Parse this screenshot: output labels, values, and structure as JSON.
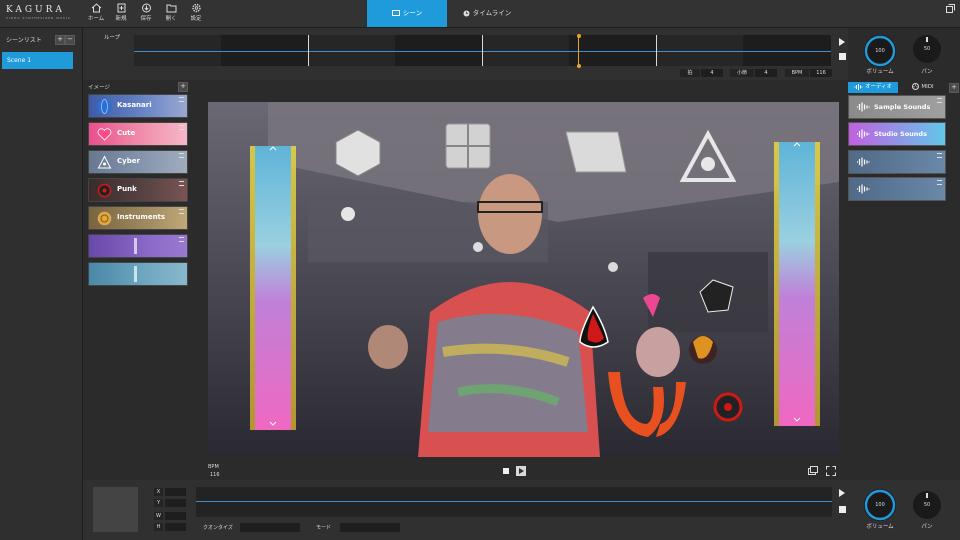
{
  "app": {
    "logo": "KAGURA",
    "logo_sub": "VIDEO SYNTHESIZER MUSIC"
  },
  "toolbar": {
    "items": [
      {
        "label": "ホーム",
        "icon": "home-icon"
      },
      {
        "label": "新規",
        "icon": "new-file-icon"
      },
      {
        "label": "保存",
        "icon": "save-icon"
      },
      {
        "label": "開く",
        "icon": "folder-open-icon"
      },
      {
        "label": "設定",
        "icon": "gear-icon"
      }
    ]
  },
  "tabs": {
    "scene": "シーン",
    "timeline": "タイムライン",
    "active": "scene"
  },
  "scene_list": {
    "title": "シーンリスト",
    "add": "+",
    "remove": "−",
    "items": [
      "Scene 1"
    ]
  },
  "loop": {
    "label": "ループ",
    "beat_label": "拍",
    "beat_value": "4",
    "measure_label": "小節",
    "measure_value": "4",
    "bpm_label": "BPM",
    "bpm_value": "116"
  },
  "master": {
    "volume_value": "100",
    "volume_label": "ボリューム",
    "pan_value": "50",
    "pan_label": "パン"
  },
  "images": {
    "title": "イメージ",
    "add": "+",
    "items": [
      {
        "name": "Kasanari",
        "icon": "globe-icon",
        "color": "#3c5aa8"
      },
      {
        "name": "Cute",
        "icon": "heart-icon",
        "color": "#e85c8c"
      },
      {
        "name": "Cyber",
        "icon": "triangle-node-icon",
        "color": "#6c7d95"
      },
      {
        "name": "Punk",
        "icon": "skull-icon",
        "color": "#4a3838"
      },
      {
        "name": "Instruments",
        "icon": "gold-coin-icon",
        "color": "#8a7346"
      },
      {
        "name": "",
        "icon": "",
        "color": "#7858b8"
      },
      {
        "name": "",
        "icon": "",
        "color": "#4f8fb0"
      }
    ]
  },
  "audio": {
    "tab_audio": "オーディオ",
    "tab_midi": "MIDI",
    "add": "+",
    "items": [
      {
        "name": "Sample Sounds",
        "color": "#8c8c8c"
      },
      {
        "name": "Studio Sounds",
        "color": "#c070e0"
      },
      {
        "name": "",
        "color": "#5a7590"
      },
      {
        "name": "",
        "color": "#5a7590"
      }
    ]
  },
  "video": {
    "bpm_label": "BPM",
    "bpm_value": "116"
  },
  "bottom": {
    "x_label": "X",
    "y_label": "Y",
    "w_label": "W",
    "h_label": "H",
    "quantize_label": "クオンタイズ",
    "mode_label": "モード",
    "volume_value": "100",
    "volume_label": "ボリューム",
    "pan_value": "50",
    "pan_label": "パン"
  },
  "colors": {
    "accent": "#1f9bdc",
    "playhead": "#e8a32a"
  }
}
